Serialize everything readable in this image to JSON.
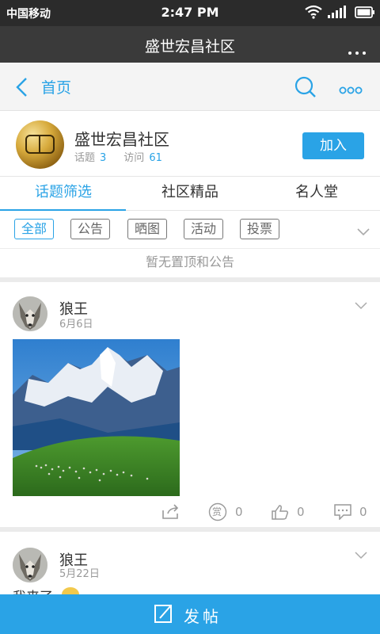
{
  "status_bar": {
    "carrier": "中国移动",
    "time": "2:47 PM"
  },
  "title_bar": {
    "title": "盛世宏昌社区"
  },
  "nav": {
    "back_label": "首页"
  },
  "community": {
    "name": "盛世宏昌社区",
    "topics_label": "话题",
    "topics_count": "3",
    "visits_label": "访问",
    "visits_count": "61",
    "join_label": "加入"
  },
  "tabs": [
    {
      "label": "话题筛选",
      "active": true
    },
    {
      "label": "社区精品",
      "active": false
    },
    {
      "label": "名人堂",
      "active": false
    }
  ],
  "filters": [
    {
      "label": "全部",
      "active": true
    },
    {
      "label": "公告",
      "active": false
    },
    {
      "label": "晒图",
      "active": false
    },
    {
      "label": "活动",
      "active": false
    },
    {
      "label": "投票",
      "active": false
    }
  ],
  "notice": "暂无置顶和公告",
  "posts": [
    {
      "author": "狼王",
      "date": "6月6日",
      "image": "mountain-landscape-photo",
      "reward_label": "赏",
      "reward_count": "0",
      "like_count": "0",
      "comment_count": "0"
    },
    {
      "author": "狼王",
      "date": "5月22日",
      "content": "我来了"
    }
  ],
  "bottom_bar": {
    "compose_label": "发帖"
  },
  "colors": {
    "accent": "#2aa3e6",
    "title_bar": "#3a3a3a",
    "status_bar": "#2b2b2b"
  }
}
